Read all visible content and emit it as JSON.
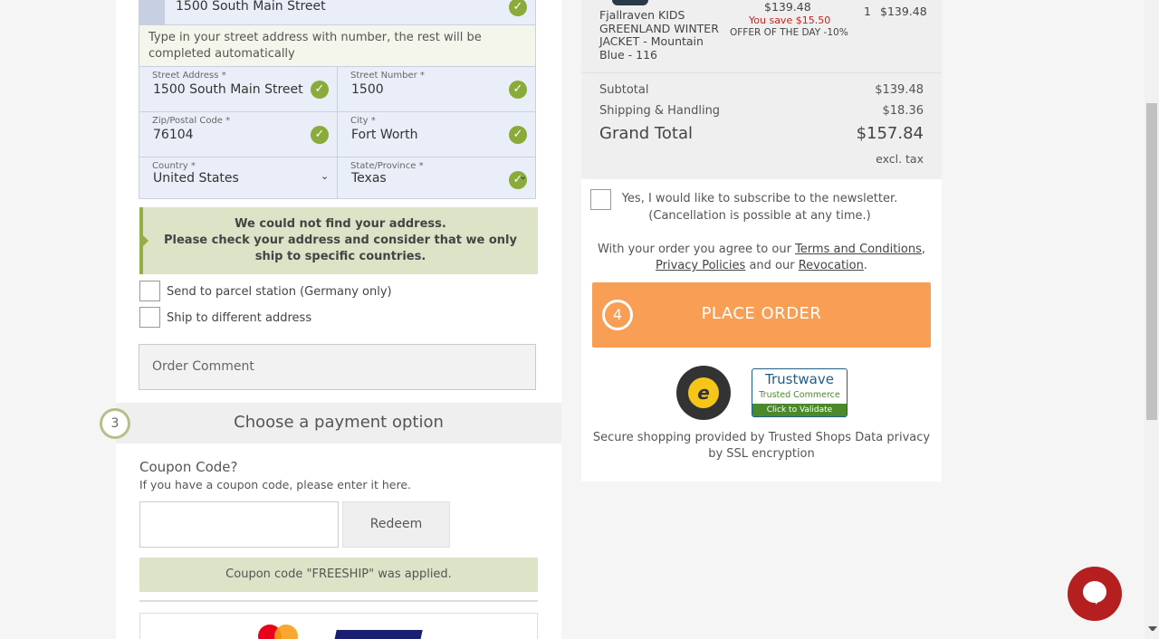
{
  "address": {
    "top_field_value": "1500 South Main Street",
    "hint": "Type in your street address with number, the rest will be completed automatically",
    "street_label": "Street Address *",
    "street_value": "1500 South Main Street",
    "number_label": "Street Number *",
    "number_value": "1500",
    "zip_label": "Zip/Postal Code *",
    "zip_value": "76104",
    "city_label": "City *",
    "city_value": "Fort Worth",
    "country_label": "Country *",
    "country_value": "United States",
    "state_label": "State/Province *",
    "state_value": "Texas"
  },
  "warning": {
    "line1": "We could not find your address.",
    "line2": "Please check your address and consider that we only ship to specific countries."
  },
  "options": {
    "parcel_label": "Send to parcel station (Germany only)",
    "different_label": "Ship to different address"
  },
  "comment": {
    "placeholder": "Order Comment"
  },
  "payment_step": {
    "number": "3",
    "title": "Choose a payment option"
  },
  "coupon": {
    "title": "Coupon Code?",
    "subtitle": "If you have a coupon code, please enter it here.",
    "redeem_label": "Redeem",
    "applied_msg": "Coupon code \"FREESHIP\" was applied."
  },
  "cart": {
    "product_name": "Fjallraven KIDS GREENLAND WINTER JACKET - Mountain Blue - 116",
    "price": "$139.48",
    "savings": "You save $15.50",
    "offer": "OFFER OF THE DAY -10%",
    "qty": "1",
    "line_total": "$139.48",
    "subtotal_label": "Subtotal",
    "subtotal_value": "$139.48",
    "shipping_label": "Shipping & Handling",
    "shipping_value": "$18.36",
    "grand_label": "Grand Total",
    "grand_value": "$157.84",
    "tax_note": "excl. tax"
  },
  "newsletter": {
    "line1": "Yes, I would like to subscribe to the newsletter.",
    "line2": "(Cancellation is possible at any time.)"
  },
  "agree": {
    "prefix": "With your order you agree to our",
    "terms": "Terms and Conditions",
    "privacy": "Privacy Policies",
    "and": "and our",
    "revocation": "Revocation"
  },
  "place_order": {
    "number": "4",
    "label": "PLACE ORDER"
  },
  "trust": {
    "trustwave_top": "Trustwave",
    "trustwave_mid": "Trusted Commerce",
    "trustwave_bottom": "Click to Validate",
    "secure_text": "Secure shopping provided by Trusted Shops Data privacy by SSL encryption"
  },
  "colors": {
    "accent_orange": "#f99e55",
    "valid_green": "#8aaa3a",
    "warning_bg": "#dce3c6",
    "chat_red": "#b51f1f"
  }
}
